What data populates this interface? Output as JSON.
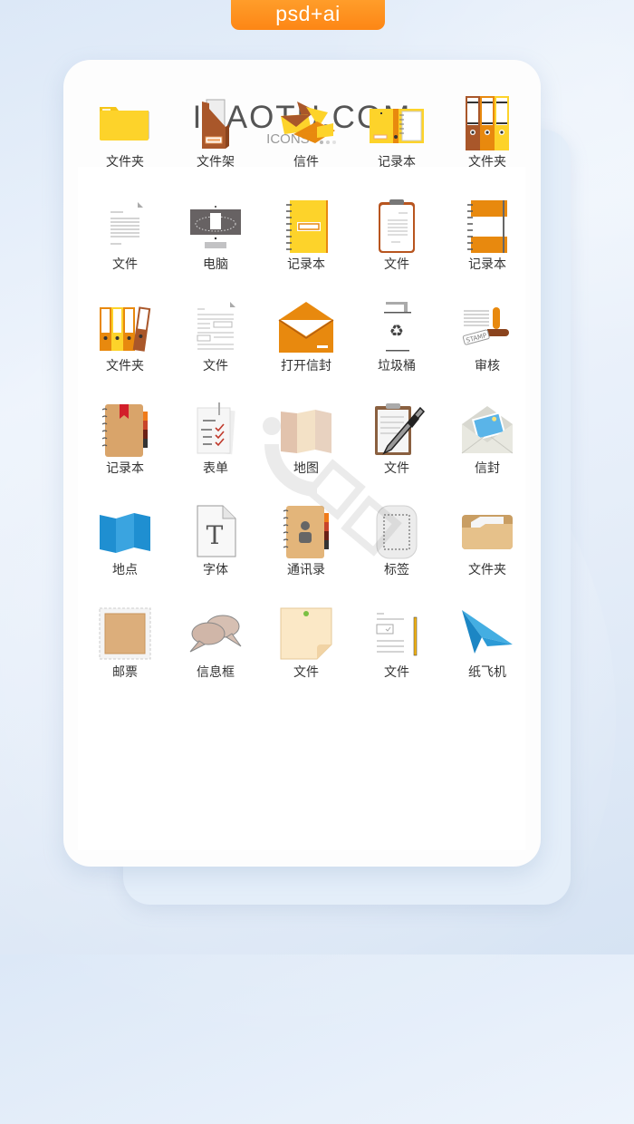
{
  "badge": {
    "label": "psd+ai"
  },
  "header": {
    "brand": "IBAOTU.COM",
    "subtitle": "ICONS"
  },
  "colors": {
    "badge": "#fd8a1a",
    "brand_text": "#555555",
    "background": "#e6eef9"
  },
  "icons": [
    {
      "label": "文件夹",
      "icon": "yellow-folder-icon"
    },
    {
      "label": "文件架",
      "icon": "file-holder-icon"
    },
    {
      "label": "信件",
      "icon": "letters-icon"
    },
    {
      "label": "记录本",
      "icon": "open-binder-icon"
    },
    {
      "label": "文件夹",
      "icon": "binders-icon"
    },
    {
      "label": "文件",
      "icon": "document-icon"
    },
    {
      "label": "电脑",
      "icon": "computer-icon"
    },
    {
      "label": "记录本",
      "icon": "yellow-notebook-icon"
    },
    {
      "label": "文件",
      "icon": "clipboard-icon"
    },
    {
      "label": "记录本",
      "icon": "orange-notebook-icon"
    },
    {
      "label": "文件夹",
      "icon": "binders-row-icon"
    },
    {
      "label": "文件",
      "icon": "layout-document-icon"
    },
    {
      "label": "打开信封",
      "icon": "open-envelope-icon"
    },
    {
      "label": "垃圾桶",
      "icon": "recycle-bin-icon"
    },
    {
      "label": "审核",
      "icon": "stamp-icon"
    },
    {
      "label": "记录本",
      "icon": "address-book-bookmark-icon"
    },
    {
      "label": "表单",
      "icon": "checklist-form-icon"
    },
    {
      "label": "地图",
      "icon": "paper-map-icon"
    },
    {
      "label": "文件",
      "icon": "clipboard-pen-icon"
    },
    {
      "label": "信封",
      "icon": "photo-envelope-icon"
    },
    {
      "label": "地点",
      "icon": "blue-map-icon"
    },
    {
      "label": "字体",
      "icon": "font-file-icon"
    },
    {
      "label": "通讯录",
      "icon": "contacts-book-icon"
    },
    {
      "label": "标签",
      "icon": "tag-icon"
    },
    {
      "label": "文件夹",
      "icon": "tan-folder-icon"
    },
    {
      "label": "邮票",
      "icon": "postage-stamp-icon"
    },
    {
      "label": "信息框",
      "icon": "chat-bubbles-icon"
    },
    {
      "label": "文件",
      "icon": "sticky-note-icon"
    },
    {
      "label": "文件",
      "icon": "checklist-pencil-icon"
    },
    {
      "label": "纸飞机",
      "icon": "paper-plane-icon"
    }
  ]
}
